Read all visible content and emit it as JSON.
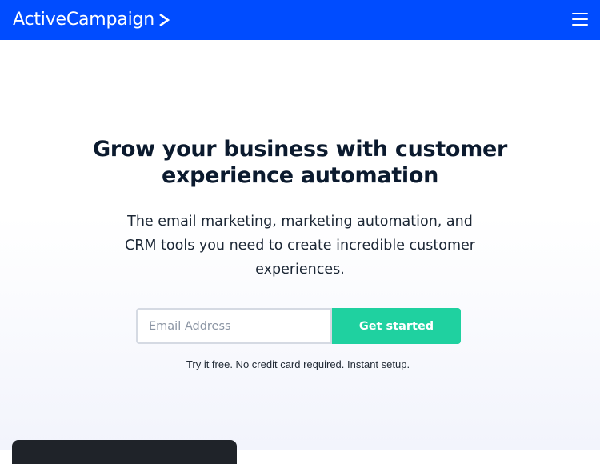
{
  "header": {
    "logo_text": "ActiveCampaign",
    "logo_icon": "chevron-right-icon",
    "menu_icon": "hamburger-menu-icon",
    "background_color": "#004cff"
  },
  "hero": {
    "headline": "Grow your business with customer experience automation",
    "subtext": "The email marketing, marketing automation, and CRM tools you need to create incredible customer experiences."
  },
  "signup_form": {
    "email_placeholder": "Email Address",
    "email_value": "",
    "button_label": "Get started",
    "button_color": "#1fd1a0",
    "fineprint": "Try it free. No credit card required. Instant setup."
  }
}
